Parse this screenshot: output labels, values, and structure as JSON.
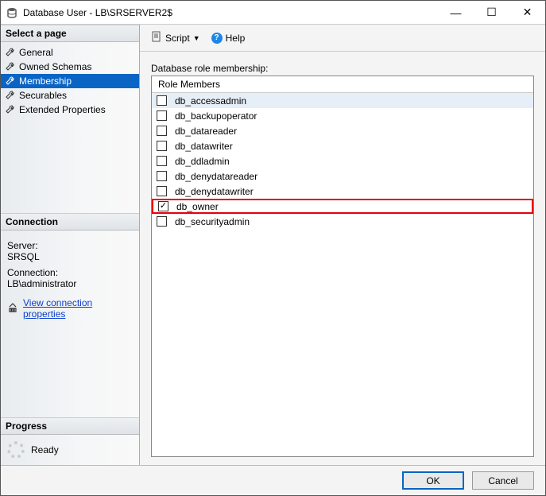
{
  "title": "Database User - LB\\SRSERVER2$",
  "window_controls": {
    "min": "—",
    "max": "☐",
    "close": "✕"
  },
  "sidebar": {
    "select_page": "Select a page",
    "items": [
      {
        "label": "General",
        "selected": false
      },
      {
        "label": "Owned Schemas",
        "selected": false
      },
      {
        "label": "Membership",
        "selected": true
      },
      {
        "label": "Securables",
        "selected": false
      },
      {
        "label": "Extended Properties",
        "selected": false
      }
    ],
    "connection": {
      "header": "Connection",
      "server_label": "Server:",
      "server_value": "SRSQL",
      "conn_label": "Connection:",
      "conn_value": "LB\\administrator",
      "link": "View connection properties"
    },
    "progress": {
      "header": "Progress",
      "status": "Ready"
    }
  },
  "toolbar": {
    "script": "Script",
    "help": "Help"
  },
  "main": {
    "group_label": "Database role membership:",
    "column_header": "Role Members",
    "roles": [
      {
        "label": "db_accessadmin",
        "checked": false,
        "row_selected": true
      },
      {
        "label": "db_backupoperator",
        "checked": false
      },
      {
        "label": "db_datareader",
        "checked": false
      },
      {
        "label": "db_datawriter",
        "checked": false
      },
      {
        "label": "db_ddladmin",
        "checked": false
      },
      {
        "label": "db_denydatareader",
        "checked": false
      },
      {
        "label": "db_denydatawriter",
        "checked": false
      },
      {
        "label": "db_owner",
        "checked": true,
        "highlight": true
      },
      {
        "label": "db_securityadmin",
        "checked": false
      }
    ]
  },
  "buttons": {
    "ok": "OK",
    "cancel": "Cancel"
  }
}
